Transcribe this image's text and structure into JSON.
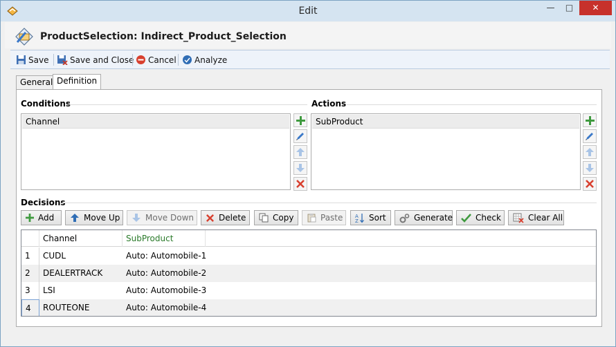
{
  "window": {
    "title": "Edit",
    "minimize_glyph": "—",
    "maximize_glyph": "□",
    "close_glyph": "✕"
  },
  "header": {
    "title": "ProductSelection: Indirect_Product_Selection"
  },
  "toolbar": {
    "save_label": "Save",
    "save_close_label": "Save and Close",
    "cancel_label": "Cancel",
    "analyze_label": "Analyze"
  },
  "tabs": [
    {
      "label": "General",
      "active": false
    },
    {
      "label": "Definition",
      "active": true
    }
  ],
  "conditions": {
    "title": "Conditions",
    "items": [
      "Channel"
    ]
  },
  "actions": {
    "title": "Actions",
    "items": [
      "SubProduct"
    ]
  },
  "decisions": {
    "title": "Decisions",
    "buttons": {
      "add": "Add",
      "move_up": "Move Up",
      "move_down": "Move Down",
      "delete": "Delete",
      "copy": "Copy",
      "paste": "Paste",
      "sort": "Sort",
      "generate": "Generate",
      "check": "Check",
      "clear_all": "Clear All"
    },
    "grid": {
      "columns": [
        "Channel",
        "SubProduct"
      ],
      "rows": [
        {
          "num": "1",
          "channel": "CUDL",
          "subproduct": "Auto: Automobile-1"
        },
        {
          "num": "2",
          "channel": "DEALERTRACK",
          "subproduct": "Auto: Automobile-2"
        },
        {
          "num": "3",
          "channel": "LSI",
          "subproduct": "Auto: Automobile-3"
        },
        {
          "num": "4",
          "channel": "ROUTEONE",
          "subproduct": "Auto: Automobile-4"
        }
      ]
    }
  },
  "colors": {
    "titlebar": "#d5e4f1",
    "close_button": "#c7312b",
    "action_column_header": "#2a7a2a",
    "add_icon": "#3f9a3f",
    "delete_icon": "#d8402f",
    "arrow_icon": "#4a7fc4"
  }
}
